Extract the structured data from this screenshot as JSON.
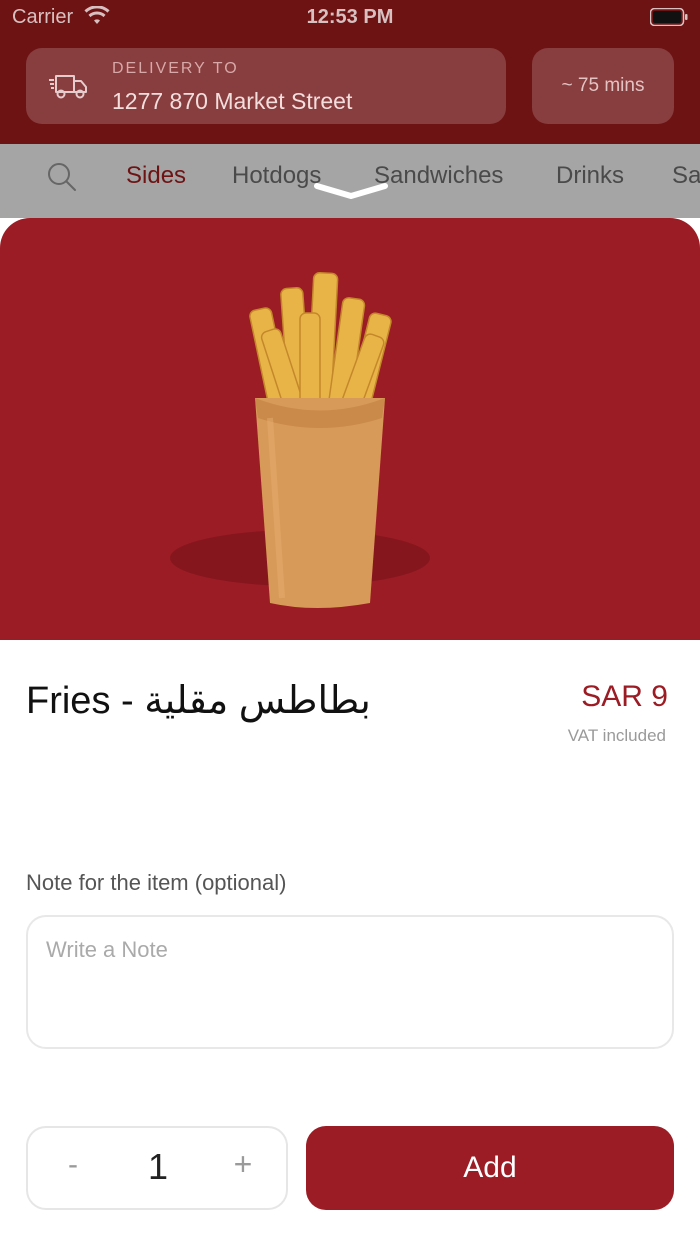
{
  "status_bar": {
    "carrier": "Carrier",
    "time": "12:53 PM"
  },
  "header": {
    "delivery_label": "DELIVERY TO",
    "delivery_address": "1277 870 Market Street",
    "eta": "~ 75 mins"
  },
  "categories": {
    "search_icon": "search-icon",
    "tabs": [
      {
        "label": "Sides",
        "active": true
      },
      {
        "label": "Hotdogs",
        "active": false
      },
      {
        "label": "Sandwiches",
        "active": false
      },
      {
        "label": "Drinks",
        "active": false
      },
      {
        "label": "Sa",
        "active": false
      }
    ]
  },
  "item": {
    "title": "Fries - بطاطس مقلية",
    "price": "SAR 9",
    "vat_note": "VAT included"
  },
  "note": {
    "label": "Note for the item (optional)",
    "placeholder": "Write a Note",
    "value": ""
  },
  "quantity": {
    "minus": "-",
    "value": "1",
    "plus": "+"
  },
  "actions": {
    "add_label": "Add"
  },
  "colors": {
    "brand_red": "#9b1c24",
    "header_red": "#6e1314"
  }
}
